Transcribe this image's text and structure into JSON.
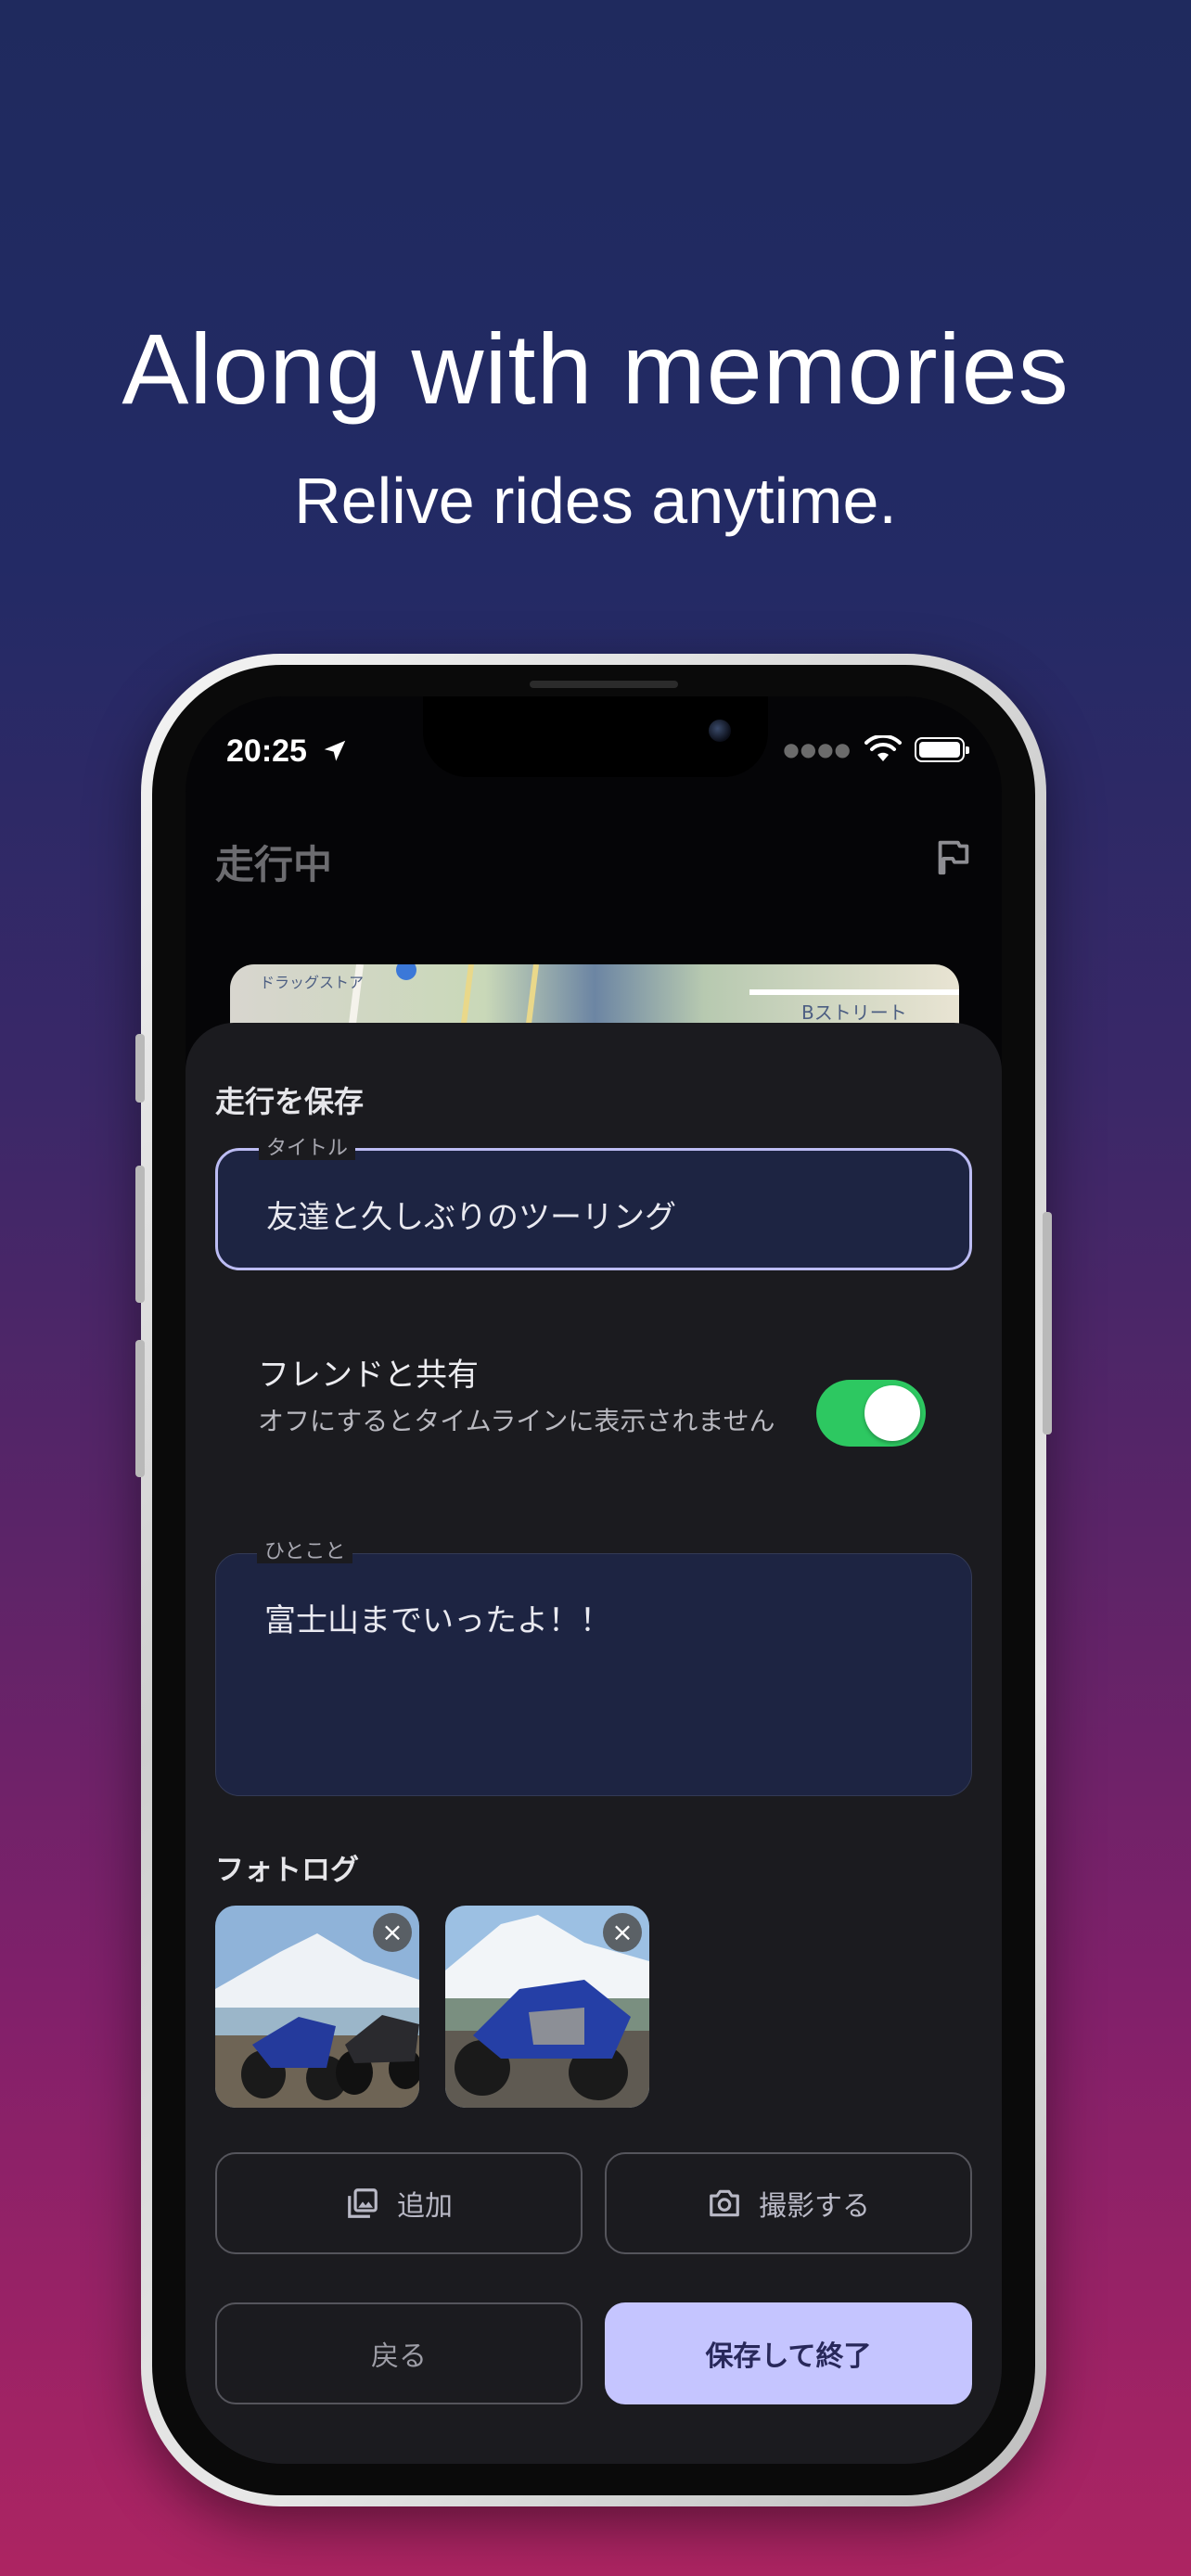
{
  "hero": {
    "headline": "Along with memories",
    "subhead": "Relive rides anytime."
  },
  "status_bar": {
    "time": "20:25"
  },
  "app": {
    "title": "走行中"
  },
  "map": {
    "label_left": "ドラッグストア",
    "label_right": "Bストリート"
  },
  "save_sheet": {
    "title": "走行を保存",
    "title_field": {
      "label": "タイトル",
      "value": "友達と久しぶりのツーリング"
    },
    "share": {
      "title": "フレンドと共有",
      "description": "オフにするとタイムラインに表示されません",
      "enabled": true
    },
    "note_field": {
      "label": "ひとこと",
      "value": "富士山までいったよ！！"
    },
    "photolog": {
      "label": "フォトログ",
      "photos": [
        {
          "remove_label": "×"
        },
        {
          "remove_label": "×"
        }
      ]
    },
    "buttons": {
      "add": "追加",
      "shoot": "撮影する",
      "back": "戻る",
      "save": "保存して終了"
    }
  },
  "colors": {
    "accent": "#c5c5ff",
    "toggle_on": "#2dc861",
    "field_border": "#bcbcf3"
  }
}
